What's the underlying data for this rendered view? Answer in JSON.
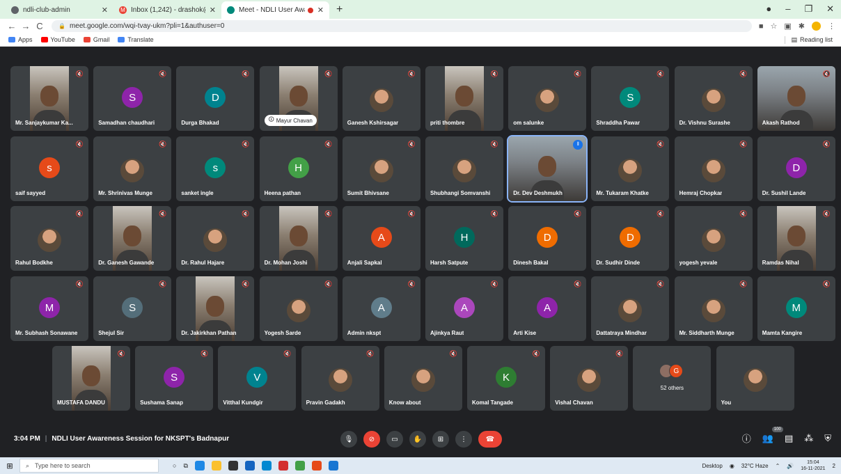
{
  "browser": {
    "tabs": [
      {
        "title": "ndli-club-admin",
        "active": false,
        "favicon_color": "#5f6368"
      },
      {
        "title": "Inbox (1,242) - drashok@nkspt.in",
        "active": false,
        "favicon_color": "#ea4335"
      },
      {
        "title": "Meet - NDLI User Awareness",
        "active": true,
        "favicon_color": "#00897b"
      }
    ],
    "new_tab": "+",
    "window_controls": [
      "–",
      "❐",
      "✕"
    ],
    "url": "meet.google.com/wqi-tvay-ukm?pli=1&authuser=0",
    "bookmarks": [
      {
        "label": "Apps",
        "color": "#4285f4"
      },
      {
        "label": "YouTube",
        "color": "#ff0000"
      },
      {
        "label": "Gmail",
        "color": "#ea4335"
      },
      {
        "label": "Translate",
        "color": "#4285f4"
      }
    ],
    "reading_list": "Reading list"
  },
  "participants": [
    {
      "name": "Mr. Sanjaykumar Ka...",
      "kind": "video"
    },
    {
      "name": "Samadhan chaudhari",
      "kind": "letter",
      "letter": "S",
      "color": "#8e24aa"
    },
    {
      "name": "Durga Bhakad",
      "kind": "letter",
      "letter": "D",
      "color": "#00838f"
    },
    {
      "name": "Mayur Chavan",
      "kind": "video-chip"
    },
    {
      "name": "Ganesh Kshirsagar",
      "kind": "photo"
    },
    {
      "name": "priti thombre",
      "kind": "video"
    },
    {
      "name": "om salunke",
      "kind": "photo"
    },
    {
      "name": "Shraddha Pawar",
      "kind": "letter",
      "letter": "S",
      "color": "#00897b"
    },
    {
      "name": "Dr. Vishnu Surashe",
      "kind": "photo"
    },
    {
      "name": "Akash Rathod",
      "kind": "video-wide"
    },
    {
      "name": "saif sayyed",
      "kind": "letter",
      "letter": "s",
      "color": "#e64a19"
    },
    {
      "name": "Mr. Shrinivas Munge",
      "kind": "photo"
    },
    {
      "name": "sanket ingle",
      "kind": "letter",
      "letter": "s",
      "color": "#00897b"
    },
    {
      "name": "Heena pathan",
      "kind": "letter",
      "letter": "H",
      "color": "#43a047"
    },
    {
      "name": "Sumit Bhivsane",
      "kind": "photo"
    },
    {
      "name": "Shubhangi Somvanshi",
      "kind": "photo"
    },
    {
      "name": "Dr. Dev Deshmukh",
      "kind": "video-wide",
      "speaking": true
    },
    {
      "name": "Mr. Tukaram Khatke",
      "kind": "photo"
    },
    {
      "name": "Hemraj Chopkar",
      "kind": "photo"
    },
    {
      "name": "Dr. Sushil Lande",
      "kind": "letter",
      "letter": "D",
      "color": "#8e24aa"
    },
    {
      "name": "Rahul Bodkhe",
      "kind": "photo"
    },
    {
      "name": "Dr. Ganesh Gawande",
      "kind": "video"
    },
    {
      "name": "Dr. Rahul Hajare",
      "kind": "photo"
    },
    {
      "name": "Dr. Mohan Joshi",
      "kind": "video"
    },
    {
      "name": "Anjali Sapkal",
      "kind": "letter",
      "letter": "A",
      "color": "#e64a19"
    },
    {
      "name": "Harsh Satpute",
      "kind": "letter",
      "letter": "H",
      "color": "#00695c"
    },
    {
      "name": "Dinesh Bakal",
      "kind": "letter",
      "letter": "D",
      "color": "#ef6c00"
    },
    {
      "name": "Dr. Sudhir Dinde",
      "kind": "letter",
      "letter": "D",
      "color": "#ef6c00"
    },
    {
      "name": "yogesh yevale",
      "kind": "photo"
    },
    {
      "name": "Ramdas Nihal",
      "kind": "video"
    },
    {
      "name": "Mr. Subhash Sonawane",
      "kind": "letter",
      "letter": "M",
      "color": "#8e24aa"
    },
    {
      "name": "Shejul Sir",
      "kind": "letter",
      "letter": "S",
      "color": "#546e7a"
    },
    {
      "name": "Dr. Jakirkhan Pathan",
      "kind": "video"
    },
    {
      "name": "Yogesh Sarde",
      "kind": "photo"
    },
    {
      "name": "Admin nkspt",
      "kind": "letter",
      "letter": "A",
      "color": "#607d8b"
    },
    {
      "name": "Ajinkya Raut",
      "kind": "letter",
      "letter": "A",
      "color": "#ab47bc"
    },
    {
      "name": "Arti Kise",
      "kind": "letter",
      "letter": "A",
      "color": "#8e24aa"
    },
    {
      "name": "Dattatraya Mindhar",
      "kind": "photo"
    },
    {
      "name": "Mr. Siddharth Munge",
      "kind": "photo"
    },
    {
      "name": "Mamta Kangire",
      "kind": "letter",
      "letter": "M",
      "color": "#00897b"
    },
    {
      "name": "MUSTAFA DANDU",
      "kind": "video"
    },
    {
      "name": "Sushama Sanap",
      "kind": "letter",
      "letter": "S",
      "color": "#8e24aa"
    },
    {
      "name": "Vitthal Kundgir",
      "kind": "letter",
      "letter": "V",
      "color": "#00838f"
    },
    {
      "name": "Pravin Gadakh",
      "kind": "photo"
    },
    {
      "name": "Know about",
      "kind": "photo"
    },
    {
      "name": "Komal Tangade",
      "kind": "letter",
      "letter": "K",
      "color": "#2e7d32"
    },
    {
      "name": "Vishal Chavan",
      "kind": "photo"
    },
    {
      "name": "52 others",
      "kind": "others"
    },
    {
      "name": "You",
      "kind": "photo"
    }
  ],
  "meeting": {
    "time": "3:04 PM",
    "separator": "|",
    "title": "NDLI User Awareness Session for NKSPT's Badnapur",
    "participant_count": "100"
  },
  "taskbar": {
    "search_placeholder": "Type here to search",
    "desktop_label": "Desktop",
    "weather": "32°C Haze",
    "time": "15:04",
    "date": "16-11-2021",
    "notification_count": "2"
  }
}
